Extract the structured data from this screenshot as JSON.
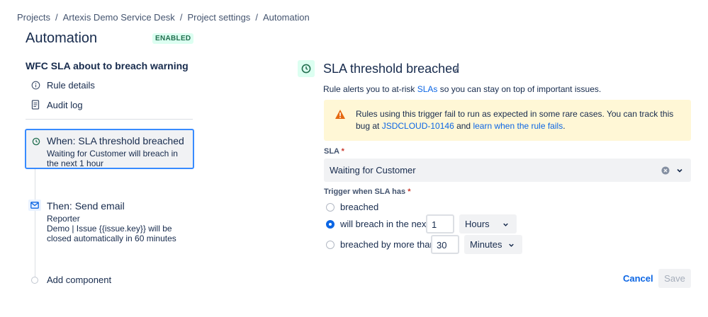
{
  "breadcrumb": [
    "Projects",
    "Artexis Demo Service Desk",
    "Project settings",
    "Automation"
  ],
  "header": {
    "title": "Automation",
    "status_badge": "ENABLED"
  },
  "rule": {
    "name": "WFC SLA about to breach warning",
    "nav": [
      {
        "label": "Rule details",
        "icon": "info-icon"
      },
      {
        "label": "Audit log",
        "icon": "document-icon"
      }
    ],
    "trigger_step": {
      "title": "When: SLA threshold breached",
      "description": "Waiting for Customer will breach in the next 1 hour",
      "icon": "clock-icon"
    },
    "action_step": {
      "title": "Then: Send email",
      "lines": [
        "Reporter",
        "Demo | Issue {{issue.key}} will be",
        "closed automatically in 60 minutes"
      ],
      "icon": "mail-icon"
    },
    "add_component_label": "Add component"
  },
  "panel": {
    "title": "SLA threshold breached",
    "description_prefix": "Rule alerts you to at-risk ",
    "description_link": "SLAs",
    "description_suffix": " so you can stay on top of important issues.",
    "warning": {
      "text_prefix": "Rules using this trigger fail to run as expected in some rare cases. You can track this bug at ",
      "link1": "JSDCLOUD-10146",
      "text_middle": " and ",
      "link2": "learn when the rule fails",
      "text_suffix": "."
    },
    "sla_field": {
      "label": "SLA",
      "value": "Waiting for Customer"
    },
    "trigger_field": {
      "label": "Trigger when SLA has",
      "options": [
        {
          "label": "breached",
          "checked": false
        },
        {
          "label": "will breach in the next",
          "checked": true,
          "number": "1",
          "unit": "Hours"
        },
        {
          "label": "breached by more than",
          "checked": false,
          "number": "30",
          "unit": "Minutes"
        }
      ]
    },
    "buttons": {
      "cancel": "Cancel",
      "save": "Save"
    }
  },
  "colors": {
    "accent": "#0c66e4",
    "selected_border": "#388bff",
    "enabled_green": "#216e4e",
    "warning_bg": "#fff7d6",
    "warning_icon": "#e56910"
  }
}
